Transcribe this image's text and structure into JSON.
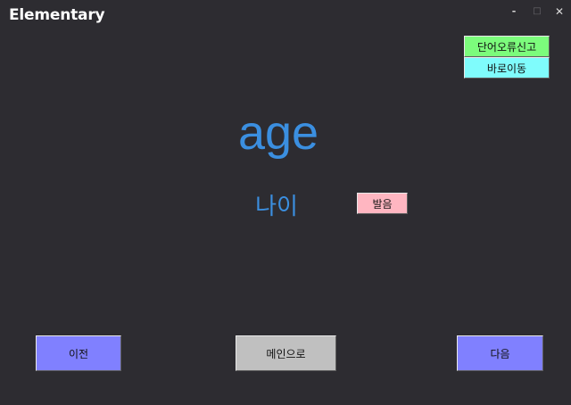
{
  "window": {
    "title": "Elementary",
    "minimize": "-",
    "maximize": "□",
    "close": "✕"
  },
  "buttons": {
    "report_error": "단어오류신고",
    "go_direct": "바로이동",
    "pronunciation": "발음",
    "previous": "이전",
    "to_main": "메인으로",
    "next": "다음"
  },
  "card": {
    "word": "age",
    "meaning": "나이"
  },
  "colors": {
    "background": "#2d2c31",
    "word_text": "#3b8fe0",
    "report_button": "#7cfc7c",
    "goto_button": "#7ffcfc",
    "pronunciation_button": "#ffb6c1",
    "nav_button": "#8080ff",
    "main_button": "#c0c0c0"
  }
}
